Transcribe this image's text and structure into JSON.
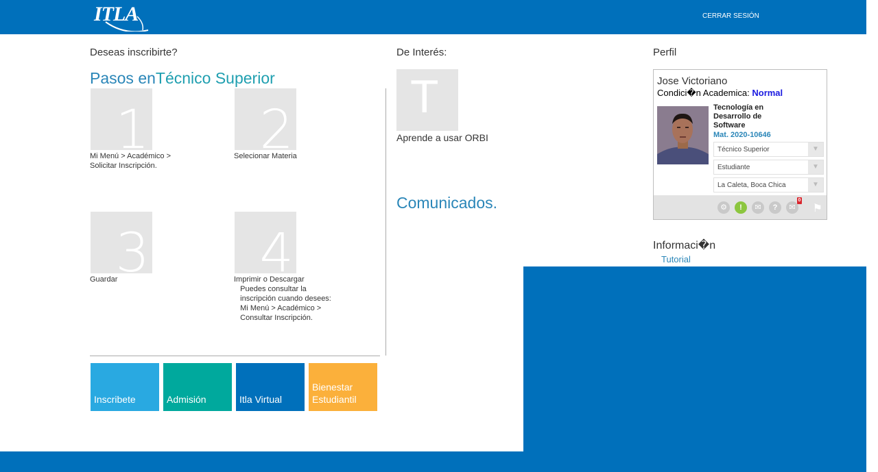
{
  "header": {
    "logo_text": "ITLA",
    "logout_label": "CERRAR SESIÓN"
  },
  "left": {
    "question": "Deseas inscribirte?",
    "steps_title_prefix": "Pasos en",
    "steps_title_program": "Técnico Superior",
    "steps": [
      {
        "number": "1",
        "caption": "Mi Menú > Académico >\nSolicitar Inscripción."
      },
      {
        "number": "2",
        "caption": "Selecionar Materia"
      },
      {
        "number": "3",
        "caption": "Guardar"
      },
      {
        "number": "4",
        "caption": "Imprimir o Descargar\n   Puedes consultar la\n   inscripción cuando desees:\n   Mi Menú > Académico >\n   Consultar Inscripción."
      }
    ],
    "quick_links": [
      {
        "label": "Inscribete",
        "color": "#29a9e1"
      },
      {
        "label": "Admisión",
        "color": "#00a99d"
      },
      {
        "label": "Itla Virtual",
        "color": "#0070bb"
      },
      {
        "label": "Bienestar\nEstudiantil",
        "color": "#fbb03b"
      }
    ]
  },
  "middle": {
    "title": "De Interés:",
    "tile_letter": "T",
    "tile_caption": "Aprende a usar ORBI",
    "announcements_title": "Comunicados."
  },
  "profile": {
    "title": "Perfil",
    "name": "Jose Victoriano",
    "condition_label": "Condici�n Academica:",
    "condition_value": "Normal",
    "career": "Tecnología en Desarrollo de Software",
    "matricula": "Mat. 2020-10646",
    "selects": [
      "Técnico Superior",
      "Estudiante",
      "La Caleta, Boca Chica"
    ],
    "icons": [
      {
        "name": "gear-icon",
        "glyph": "⚙"
      },
      {
        "name": "alert-icon",
        "glyph": "!"
      },
      {
        "name": "mail-icon",
        "glyph": "✉"
      },
      {
        "name": "help-icon",
        "glyph": "?"
      },
      {
        "name": "messages-icon",
        "glyph": "✉",
        "badge": "0"
      }
    ]
  },
  "info": {
    "title": "Informaci�n",
    "tutorial_link": "Tutorial"
  },
  "colors": {
    "brand_blue": "#0070bb",
    "link_blue": "#2a86b8",
    "tile_gray": "#e5e5e5"
  }
}
